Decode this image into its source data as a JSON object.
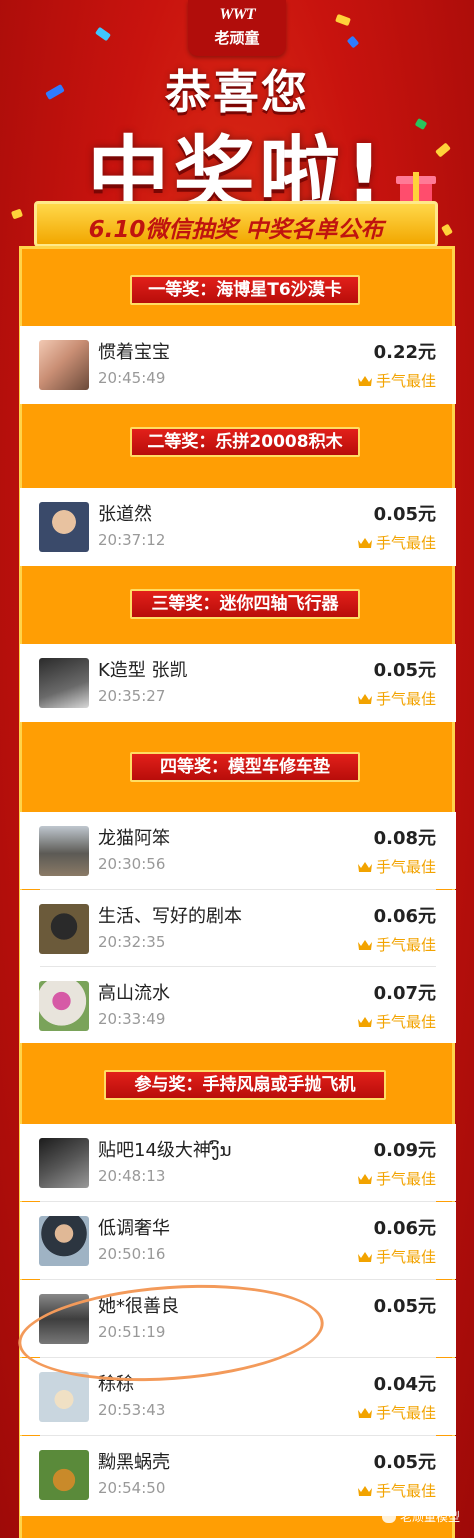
{
  "brand": {
    "logo_mark": "WWT",
    "logo_name": "老顽童"
  },
  "headline": {
    "line1": "恭喜您",
    "line2": "中奖啦!"
  },
  "banner": {
    "text": "6.10微信抽奖 中奖名单公布"
  },
  "best_luck_label": "手气最佳",
  "colors": {
    "accent_red": "#c4120e",
    "orange": "#ff9e04",
    "gold": "#f2a300"
  },
  "sections": [
    {
      "title": "一等奖：海博星T6沙漠卡",
      "winners": [
        {
          "name": "惯着宝宝",
          "time": "20:45:49",
          "amount": "0.22元",
          "best": true,
          "avatar": "couple-photo"
        }
      ]
    },
    {
      "title": "二等奖：乐拼20008积木",
      "winners": [
        {
          "name": "张道然",
          "time": "20:37:12",
          "amount": "0.05元",
          "best": true,
          "avatar": "man-glasses-photo"
        }
      ]
    },
    {
      "title": "三等奖：迷你四轴飞行器",
      "winners": [
        {
          "name": "K造型  张凯",
          "time": "20:35:27",
          "amount": "0.05元",
          "best": true,
          "avatar": "barber-photo"
        }
      ]
    },
    {
      "title": "四等奖：模型车修车垫",
      "winners": [
        {
          "name": "龙猫阿笨",
          "time": "20:30:56",
          "amount": "0.08元",
          "best": true,
          "avatar": "car-model-photo"
        },
        {
          "name": "生活、写好的剧本",
          "time": "20:32:35",
          "amount": "0.06元",
          "best": true,
          "avatar": "panther-photo"
        },
        {
          "name": "高山流水",
          "time": "20:33:49",
          "amount": "0.07元",
          "best": true,
          "avatar": "flower-photo"
        }
      ]
    },
    {
      "title": "参与奖：手持风扇或手抛飞机",
      "winners": [
        {
          "name": "贴吧14级大神ງົນ",
          "time": "20:48:13",
          "amount": "0.09元",
          "best": true,
          "avatar": "dark-car-photo"
        },
        {
          "name": "低调奢华",
          "time": "20:50:16",
          "amount": "0.06元",
          "best": true,
          "avatar": "man-outdoor-photo"
        },
        {
          "name": "她*很善良",
          "time": "20:51:19",
          "amount": "0.05元",
          "best": false,
          "avatar": "gray-photo"
        },
        {
          "name": "稌稌",
          "time": "20:53:43",
          "amount": "0.04元",
          "best": true,
          "avatar": "girl-sketch-photo"
        },
        {
          "name": "黝黑蜗壳",
          "time": "20:54:50",
          "amount": "0.05元",
          "best": true,
          "avatar": "teapot-photo"
        }
      ]
    }
  ],
  "watermark": "老顽童模型"
}
